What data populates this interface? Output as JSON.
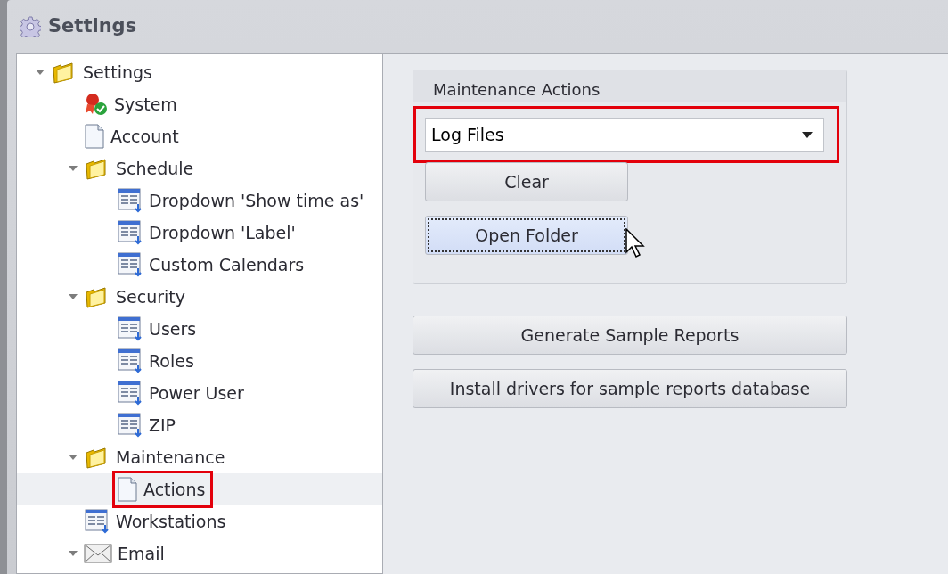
{
  "window": {
    "title": "Settings"
  },
  "tree": [
    {
      "label": "Settings",
      "kind": "folder",
      "expanded": true,
      "selected": false,
      "children": [
        {
          "label": "System",
          "kind": "ribbon",
          "selected": false
        },
        {
          "label": "Account",
          "kind": "page",
          "selected": false
        },
        {
          "label": "Schedule",
          "kind": "folder",
          "expanded": true,
          "selected": false,
          "children": [
            {
              "label": "Dropdown 'Show time as'",
              "kind": "list",
              "selected": false
            },
            {
              "label": "Dropdown 'Label'",
              "kind": "list",
              "selected": false
            },
            {
              "label": "Custom Calendars",
              "kind": "list",
              "selected": false
            }
          ]
        },
        {
          "label": "Security",
          "kind": "folder",
          "expanded": true,
          "selected": false,
          "children": [
            {
              "label": "Users",
              "kind": "list",
              "selected": false
            },
            {
              "label": "Roles",
              "kind": "list",
              "selected": false
            },
            {
              "label": "Power User",
              "kind": "list",
              "selected": false
            },
            {
              "label": "ZIP",
              "kind": "list",
              "selected": false
            }
          ]
        },
        {
          "label": "Maintenance",
          "kind": "folder",
          "expanded": true,
          "selected": false,
          "children": [
            {
              "label": "Actions",
              "kind": "page",
              "selected": true,
              "highlighted": true
            }
          ]
        },
        {
          "label": "Workstations",
          "kind": "list",
          "selected": false
        },
        {
          "label": "Email",
          "kind": "mail",
          "expanded": true,
          "selected": false
        }
      ]
    }
  ],
  "maintenance_group": {
    "title": "Maintenance Actions",
    "dropdown": {
      "value": "Log Files",
      "highlighted": true
    },
    "buttons": [
      {
        "label": "Clear",
        "focused": false
      },
      {
        "label": "Open Folder",
        "focused": true
      }
    ]
  },
  "buttons": [
    {
      "label": "Generate Sample Reports",
      "focused": false
    },
    {
      "label": "Install drivers for sample reports database",
      "focused": false
    }
  ]
}
